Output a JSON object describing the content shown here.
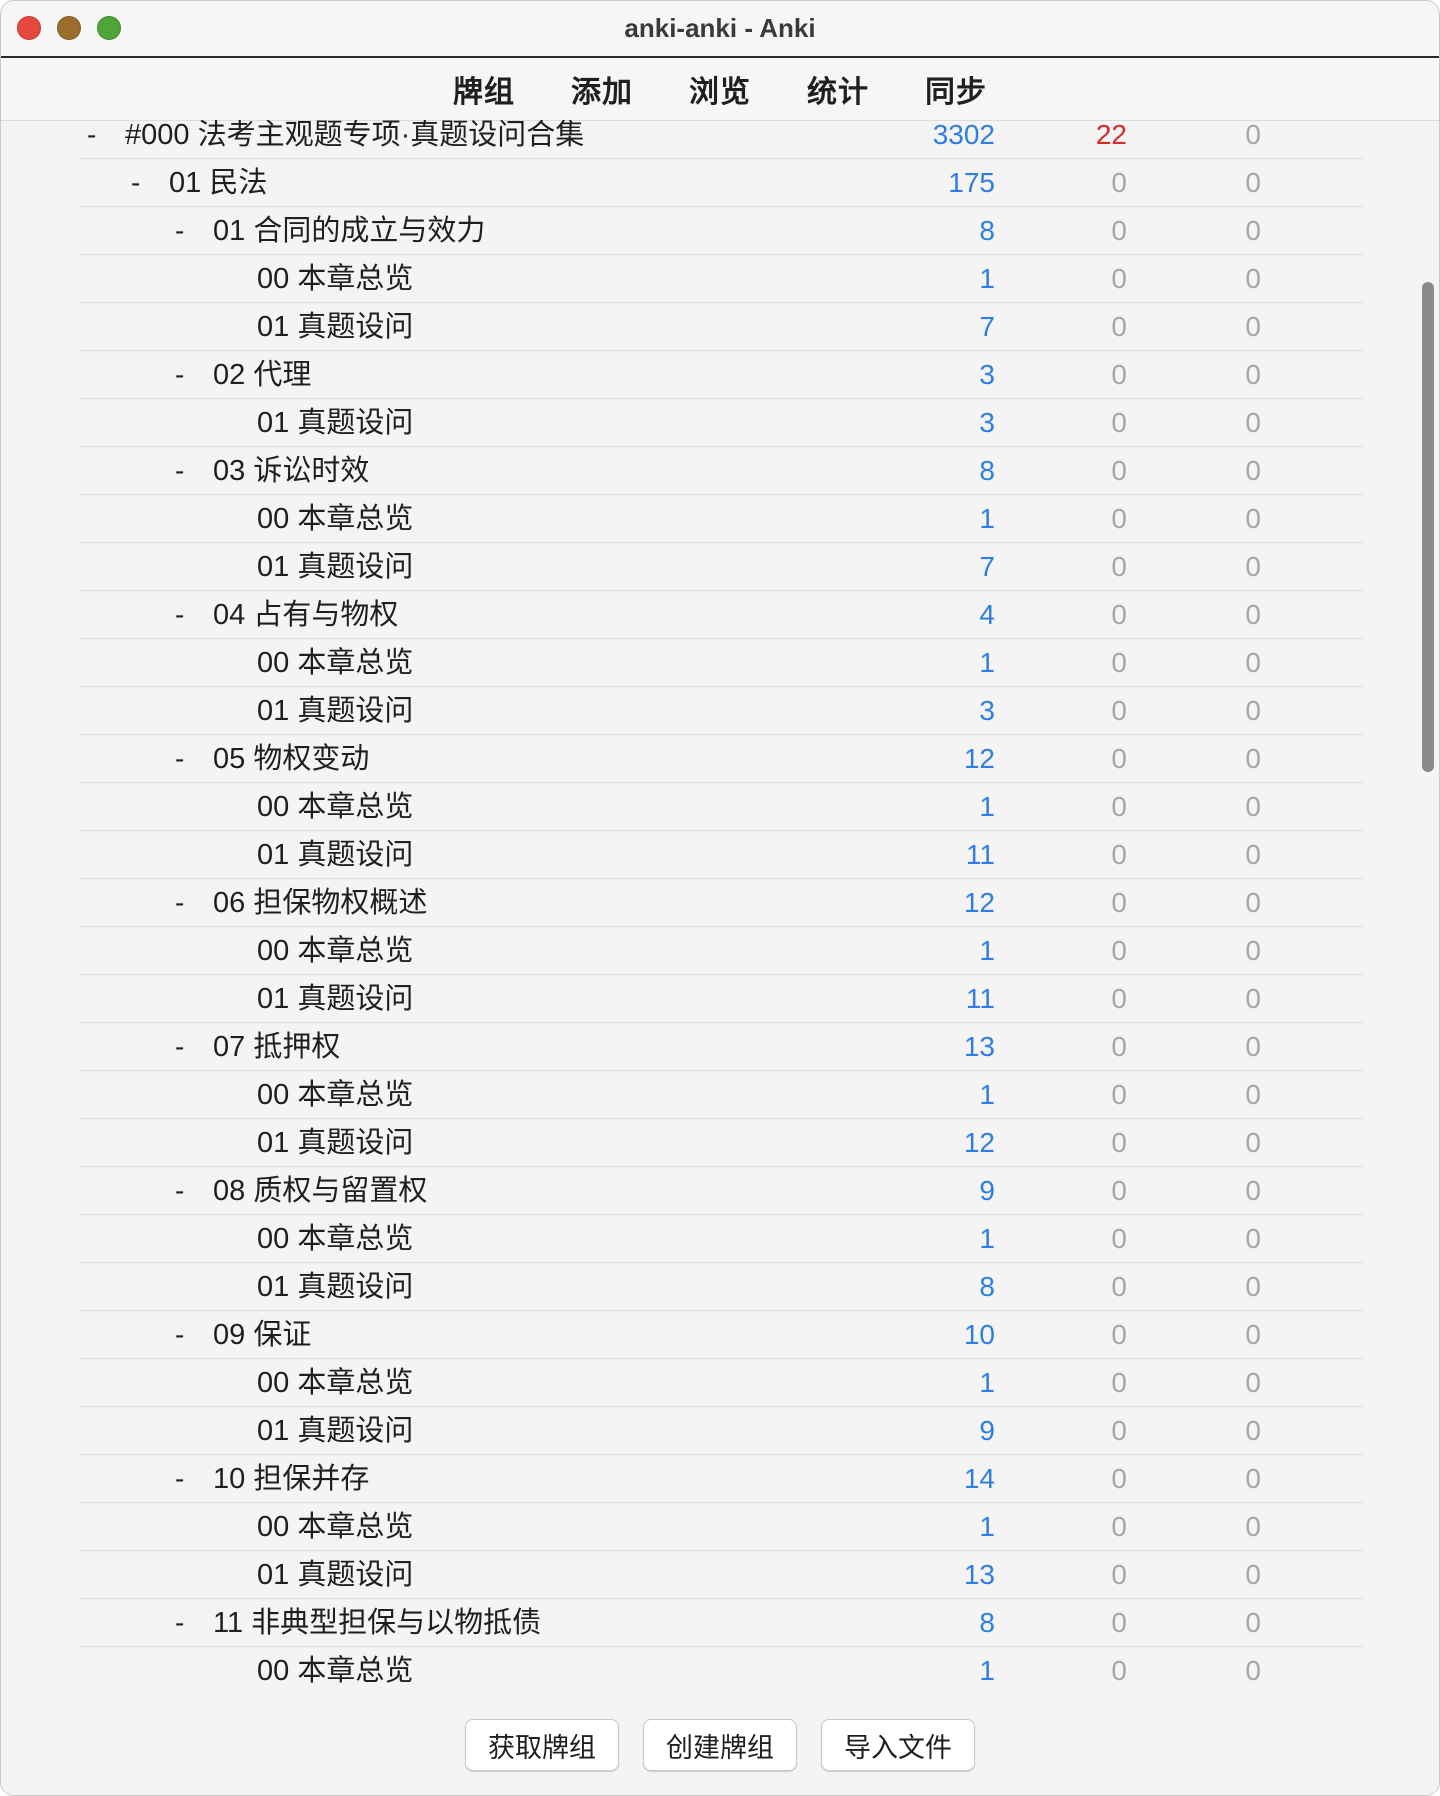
{
  "window": {
    "title": "anki-anki - Anki"
  },
  "toolbar": {
    "items": [
      {
        "label": "牌组"
      },
      {
        "label": "添加"
      },
      {
        "label": "浏览"
      },
      {
        "label": "统计"
      },
      {
        "label": "同步"
      }
    ]
  },
  "decks": [
    {
      "level": 0,
      "collapse": "-",
      "name": "#000 法考主观题专项·真题设问合集",
      "new": "3302",
      "learn": "22",
      "due": "0",
      "learn_active": true
    },
    {
      "level": 1,
      "collapse": "-",
      "name": "01 民法",
      "new": "175",
      "learn": "0",
      "due": "0"
    },
    {
      "level": 2,
      "collapse": "-",
      "name": "01 合同的成立与效力",
      "new": "8",
      "learn": "0",
      "due": "0"
    },
    {
      "level": 3,
      "collapse": "",
      "name": "00 本章总览",
      "new": "1",
      "learn": "0",
      "due": "0"
    },
    {
      "level": 3,
      "collapse": "",
      "name": "01 真题设问",
      "new": "7",
      "learn": "0",
      "due": "0"
    },
    {
      "level": 2,
      "collapse": "-",
      "name": "02 代理",
      "new": "3",
      "learn": "0",
      "due": "0"
    },
    {
      "level": 3,
      "collapse": "",
      "name": "01 真题设问",
      "new": "3",
      "learn": "0",
      "due": "0"
    },
    {
      "level": 2,
      "collapse": "-",
      "name": "03 诉讼时效",
      "new": "8",
      "learn": "0",
      "due": "0"
    },
    {
      "level": 3,
      "collapse": "",
      "name": "00 本章总览",
      "new": "1",
      "learn": "0",
      "due": "0"
    },
    {
      "level": 3,
      "collapse": "",
      "name": "01 真题设问",
      "new": "7",
      "learn": "0",
      "due": "0"
    },
    {
      "level": 2,
      "collapse": "-",
      "name": "04 占有与物权",
      "new": "4",
      "learn": "0",
      "due": "0"
    },
    {
      "level": 3,
      "collapse": "",
      "name": "00 本章总览",
      "new": "1",
      "learn": "0",
      "due": "0"
    },
    {
      "level": 3,
      "collapse": "",
      "name": "01 真题设问",
      "new": "3",
      "learn": "0",
      "due": "0"
    },
    {
      "level": 2,
      "collapse": "-",
      "name": "05 物权变动",
      "new": "12",
      "learn": "0",
      "due": "0"
    },
    {
      "level": 3,
      "collapse": "",
      "name": "00 本章总览",
      "new": "1",
      "learn": "0",
      "due": "0"
    },
    {
      "level": 3,
      "collapse": "",
      "name": "01 真题设问",
      "new": "11",
      "learn": "0",
      "due": "0"
    },
    {
      "level": 2,
      "collapse": "-",
      "name": "06 担保物权概述",
      "new": "12",
      "learn": "0",
      "due": "0"
    },
    {
      "level": 3,
      "collapse": "",
      "name": "00 本章总览",
      "new": "1",
      "learn": "0",
      "due": "0"
    },
    {
      "level": 3,
      "collapse": "",
      "name": "01 真题设问",
      "new": "11",
      "learn": "0",
      "due": "0"
    },
    {
      "level": 2,
      "collapse": "-",
      "name": "07 抵押权",
      "new": "13",
      "learn": "0",
      "due": "0"
    },
    {
      "level": 3,
      "collapse": "",
      "name": "00 本章总览",
      "new": "1",
      "learn": "0",
      "due": "0"
    },
    {
      "level": 3,
      "collapse": "",
      "name": "01 真题设问",
      "new": "12",
      "learn": "0",
      "due": "0"
    },
    {
      "level": 2,
      "collapse": "-",
      "name": "08 质权与留置权",
      "new": "9",
      "learn": "0",
      "due": "0"
    },
    {
      "level": 3,
      "collapse": "",
      "name": "00 本章总览",
      "new": "1",
      "learn": "0",
      "due": "0"
    },
    {
      "level": 3,
      "collapse": "",
      "name": "01 真题设问",
      "new": "8",
      "learn": "0",
      "due": "0"
    },
    {
      "level": 2,
      "collapse": "-",
      "name": "09 保证",
      "new": "10",
      "learn": "0",
      "due": "0"
    },
    {
      "level": 3,
      "collapse": "",
      "name": "00 本章总览",
      "new": "1",
      "learn": "0",
      "due": "0"
    },
    {
      "level": 3,
      "collapse": "",
      "name": "01 真题设问",
      "new": "9",
      "learn": "0",
      "due": "0"
    },
    {
      "level": 2,
      "collapse": "-",
      "name": "10 担保并存",
      "new": "14",
      "learn": "0",
      "due": "0"
    },
    {
      "level": 3,
      "collapse": "",
      "name": "00 本章总览",
      "new": "1",
      "learn": "0",
      "due": "0"
    },
    {
      "level": 3,
      "collapse": "",
      "name": "01 真题设问",
      "new": "13",
      "learn": "0",
      "due": "0"
    },
    {
      "level": 2,
      "collapse": "-",
      "name": "11 非典型担保与以物抵债",
      "new": "8",
      "learn": "0",
      "due": "0"
    },
    {
      "level": 3,
      "collapse": "",
      "name": "00 本章总览",
      "new": "1",
      "learn": "0",
      "due": "0"
    }
  ],
  "bottom_buttons": {
    "get_shared": "获取牌组",
    "create_deck": "创建牌组",
    "import_file": "导入文件"
  },
  "colors": {
    "new_count": "#2f7de1",
    "learn_count_active": "#d42b2b",
    "zero_count": "#a6a6a6"
  }
}
